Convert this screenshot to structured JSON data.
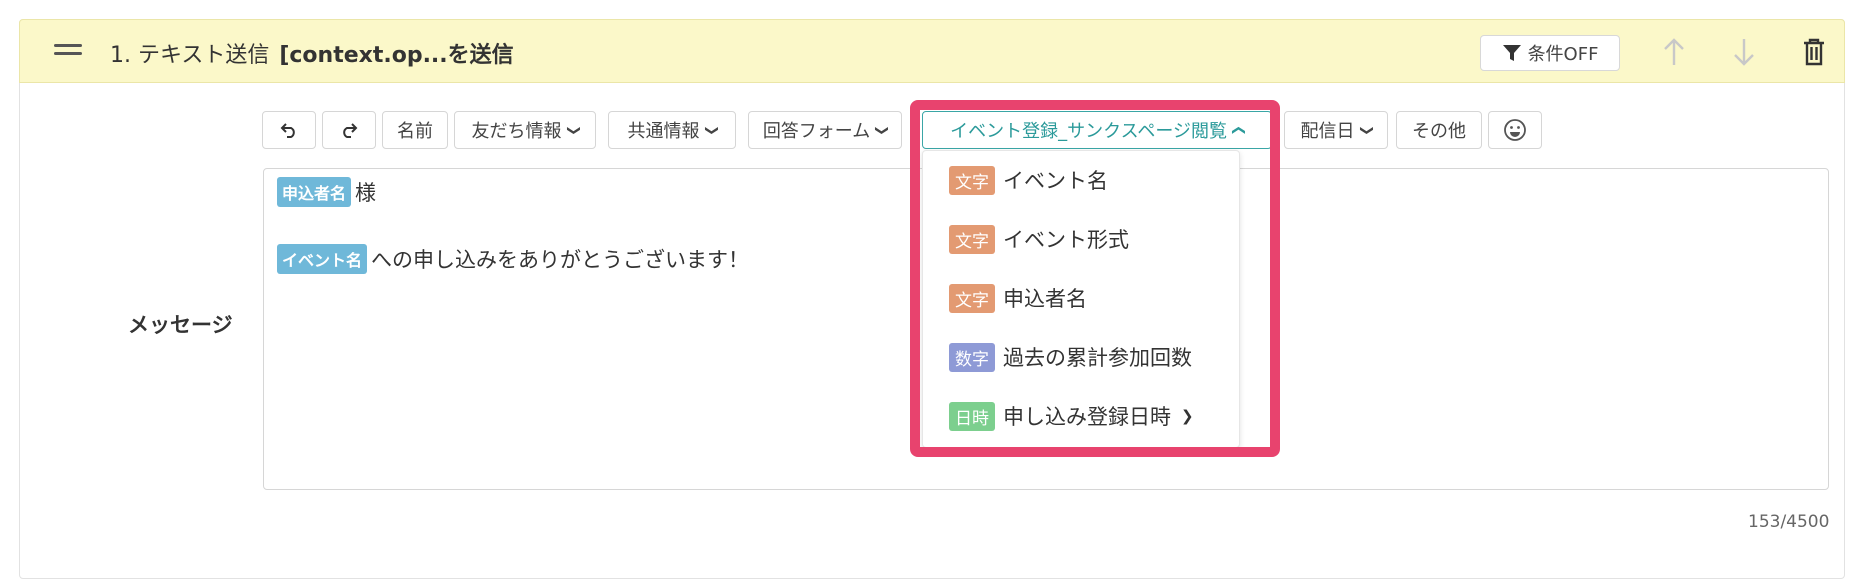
{
  "header": {
    "step_title": "1. テキスト送信",
    "step_subtitle": "[context.op...を送信",
    "condition_label": "条件OFF"
  },
  "toolbar": {
    "name_label": "名前",
    "friend_info_label": "友だち情報",
    "common_info_label": "共通情報",
    "answer_form_label": "回答フォーム",
    "event_label": "イベント登録_サンクスページ閲覧",
    "delivery_date_label": "配信日",
    "other_label": "その他"
  },
  "editor": {
    "line1_tag": "申込者名",
    "line1_text": "様",
    "line2_tag": "イベント名",
    "line2_text": "への申し込みをありがとうございます！"
  },
  "message_label": "メッセージ",
  "char_counter": "153/4500",
  "dropdown": {
    "items": [
      {
        "badge": "文字",
        "badge_color": "#e39a72",
        "label": "イベント名"
      },
      {
        "badge": "文字",
        "badge_color": "#e39a72",
        "label": "イベント形式"
      },
      {
        "badge": "文字",
        "badge_color": "#e39a72",
        "label": "申込者名"
      },
      {
        "badge": "数字",
        "badge_color": "#8e9ad6",
        "label": "過去の累計参加回数"
      },
      {
        "badge": "日時",
        "badge_color": "#7ccf8e",
        "label": "申し込み登録日時",
        "has_submenu": true
      }
    ]
  },
  "colors": {
    "header_bg": "#fbf8c9",
    "accent": "#2b9a9a",
    "highlight": "#e8436e",
    "tag_blue": "#6fb8d9"
  }
}
